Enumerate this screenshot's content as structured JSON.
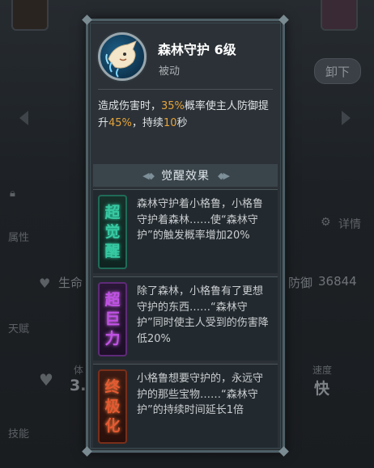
{
  "skill": {
    "name": "森林守护 6级",
    "type": "被动",
    "icon": "forest-guard-icon",
    "description": {
      "p1": "造成伤害时，",
      "v1": "35%",
      "p2": "概率使主人防御提升",
      "v2": "45%",
      "p3": "，持续",
      "v3": "10",
      "p4": "秒"
    }
  },
  "awakening": {
    "title": "觉醒效果",
    "items": [
      {
        "badge": [
          "超",
          "觉",
          "醒"
        ],
        "color": "#38c9a3",
        "text": "森林守护着小格鲁，小格鲁守护着森林……使“森林守护”的触发概率增加20%"
      },
      {
        "badge": [
          "超",
          "巨",
          "力"
        ],
        "color": "#c152e6",
        "text": "除了森林，小格鲁有了更想守护的东西……“森林守护”同时使主人受到的伤害降低20%"
      },
      {
        "badge": [
          "终",
          "极",
          "化"
        ],
        "color": "#e45a32",
        "text": "小格鲁想要守护的，永远守护的那些宝物……“森林守护”的持续时间延长1倍"
      }
    ]
  },
  "background": {
    "unequip_button": "卸下",
    "detail_label": "详情",
    "attr_label": "属性",
    "life_label": "生命",
    "defense_label": "防御",
    "defense_value": "36844",
    "talent_label": "天赋",
    "skill_label": "技能",
    "speed_label": "速度",
    "speed_value": "快",
    "body_label": "体",
    "body_value": "3."
  }
}
